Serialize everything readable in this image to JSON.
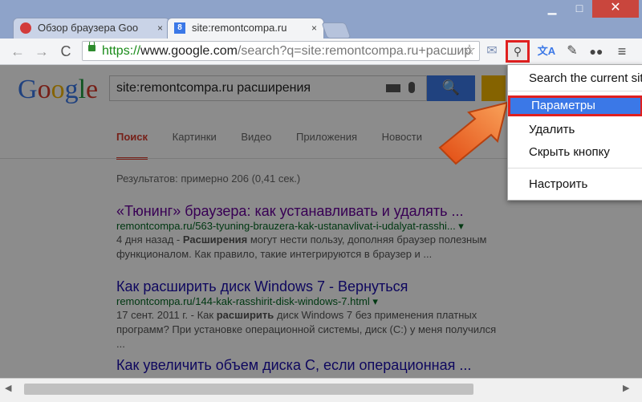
{
  "window": {
    "minimize_label": "▁",
    "maximize_label": "□",
    "close_label": "✕"
  },
  "tabs": [
    {
      "title": "Обзор браузера Goo",
      "close": "×"
    },
    {
      "title": "site:remontcompa.ru",
      "favicon": "8",
      "close": "×"
    }
  ],
  "toolbar": {
    "back": "←",
    "forward": "→",
    "reload": "C",
    "url_scheme": "https://",
    "url_host": "www.google.com",
    "url_path": "/search?q=site:remontcompa.ru+расшир",
    "star": "☆",
    "extensions": [
      "mail-icon",
      "search-extension-icon",
      "translate-icon",
      "bookmark-icon",
      "binoculars-icon"
    ],
    "menu": "≡"
  },
  "page": {
    "logo_letters": [
      "G",
      "o",
      "o",
      "g",
      "l",
      "e"
    ],
    "query": "site:remontcompa.ru расширения",
    "search_button": "🔍",
    "tabs": [
      "Поиск",
      "Картинки",
      "Видео",
      "Приложения",
      "Новости"
    ],
    "stats": "Результатов: примерно 206 (0,41 сек.)",
    "results": [
      {
        "title": "«Тюнинг» браузера: как устанавливать и удалять ...",
        "url": "remontcompa.ru/563-tyuning-brauzera-kak-ustanavlivat-i-udalyat-rasshi... ▾",
        "snippet_line1_pre": "4 дня назад - ",
        "snippet_line1_bold": "Расширения",
        "snippet_line1_post": " могут нести пользу, дополняя браузер полезным",
        "snippet_line2": "функционалом. Как правило, такие интегрируются в браузер и ..."
      },
      {
        "title": "Как расширить диск Windows 7 - Вернуться",
        "url": "remontcompa.ru/144-kak-rasshirit-disk-windows-7.html ▾",
        "snippet_line1_pre": "17 сент. 2011 г. - Как ",
        "snippet_line1_bold": "расширить",
        "snippet_line1_post": " диск Windows 7 без применения платных",
        "snippet_line2": "программ? При установке операционной системы, диск (C:) у меня получился ..."
      },
      {
        "title": "Как увеличить объем диска С, если операционная ..."
      }
    ]
  },
  "context_menu": {
    "items": [
      "Search the current site",
      "Параметры",
      "Удалить",
      "Скрыть кнопку",
      "Настроить"
    ],
    "highlighted": "Параметры"
  },
  "colors": {
    "accent": "#3b78e7",
    "highlight_border": "#e02020",
    "link": "#1a0dab",
    "url": "#006621"
  }
}
